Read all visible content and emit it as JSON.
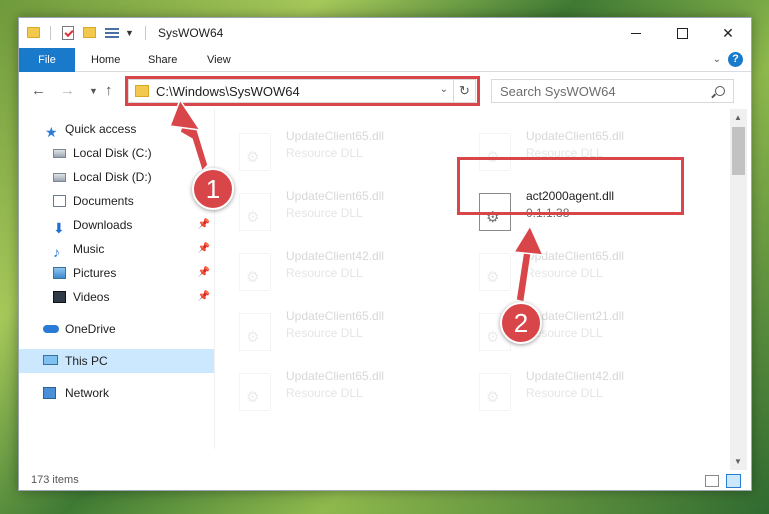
{
  "window": {
    "title": "SysWOW64"
  },
  "ribbon": {
    "tabs": [
      "File",
      "Home",
      "Share",
      "View"
    ],
    "help_glyph": "?"
  },
  "navbar": {
    "address": "C:\\Windows\\SysWOW64",
    "search_placeholder": "Search SysWOW64"
  },
  "sidebar": {
    "items": [
      {
        "label": "Quick access",
        "icon": "star-icon"
      },
      {
        "label": "Local Disk (C:)",
        "icon": "disk-icon"
      },
      {
        "label": "Local Disk (D:)",
        "icon": "disk-icon"
      },
      {
        "label": "Documents",
        "icon": "document-icon"
      },
      {
        "label": "Downloads",
        "icon": "download-icon"
      },
      {
        "label": "Music",
        "icon": "music-icon"
      },
      {
        "label": "Pictures",
        "icon": "pictures-icon"
      },
      {
        "label": "Videos",
        "icon": "video-icon"
      },
      {
        "label": "OneDrive",
        "icon": "cloud-icon"
      },
      {
        "label": "This PC",
        "icon": "computer-icon"
      },
      {
        "label": "Network",
        "icon": "network-icon"
      }
    ]
  },
  "files": [
    {
      "name": "UpdateClient65.dll",
      "desc": "Resource DLL"
    },
    {
      "name": "UpdateClient65.dll",
      "desc": "Resource DLL"
    },
    {
      "name": "UpdateClient65.dll",
      "desc": "Resource DLL"
    },
    {
      "name": "act2000agent.dll",
      "desc": "0.1.1.38"
    },
    {
      "name": "UpdateClient42.dll",
      "desc": "Resource DLL"
    },
    {
      "name": "UpdateClient65.dll",
      "desc": "Resource DLL"
    },
    {
      "name": "UpdateClient65.dll",
      "desc": "Resource DLL"
    },
    {
      "name": "UpdateClient21.dll",
      "desc": "Resource DLL"
    },
    {
      "name": "UpdateClient65.dll",
      "desc": "Resource DLL"
    },
    {
      "name": "UpdateClient42.dll",
      "desc": "Resource DLL"
    }
  ],
  "status": {
    "item_count": "173 items"
  },
  "annotations": {
    "step1": "1",
    "step2": "2",
    "accent_color": "#d9464a"
  }
}
